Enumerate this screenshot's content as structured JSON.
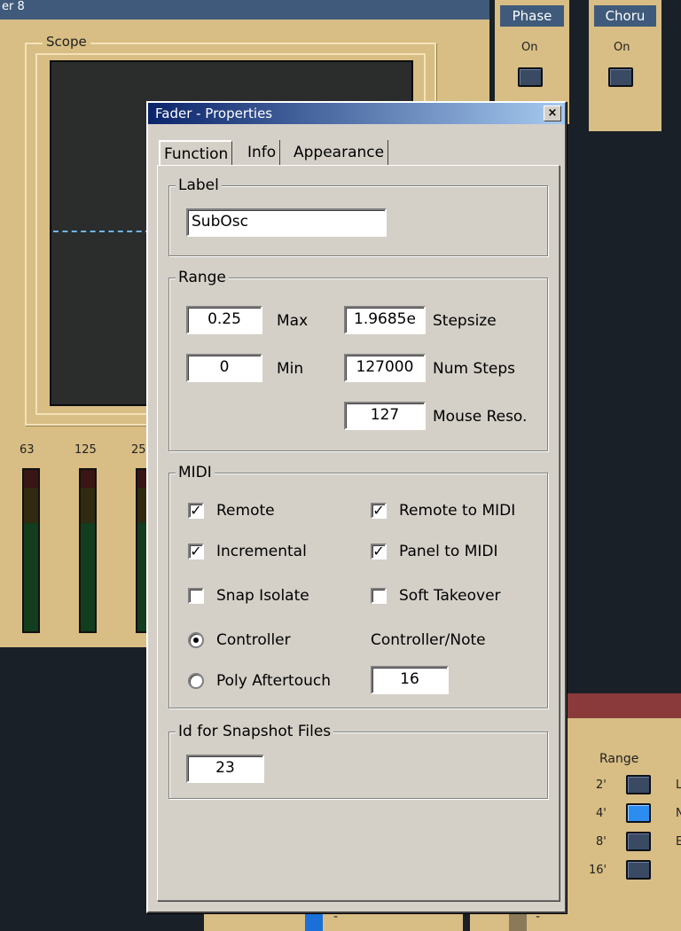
{
  "background": {
    "scope_panel_title": "er 8",
    "scope_label": "Scope",
    "meter_ticks": [
      "63",
      "125",
      "25"
    ],
    "phase": {
      "title": "Phase",
      "state": "On"
    },
    "chorus": {
      "title": "Choru",
      "state": "On"
    },
    "range_group": {
      "title": "Range",
      "options": [
        "2'",
        "4'",
        "8'",
        "16'"
      ],
      "selected": "4'",
      "side_letters": [
        "L",
        "N",
        "E"
      ]
    },
    "bottom_dashes": [
      "-",
      "-"
    ]
  },
  "dialog": {
    "title": "Fader - Properties",
    "close_glyph": "×",
    "tabs": [
      "Function",
      "Info",
      "Appearance"
    ],
    "active_tab": "Function",
    "label_group": {
      "title": "Label",
      "value": "SubOsc"
    },
    "range_group": {
      "title": "Range",
      "max": {
        "value": "0.25",
        "label": "Max"
      },
      "min": {
        "value": "0",
        "label": "Min"
      },
      "stepsize": {
        "value": "1.9685e",
        "label": "Stepsize"
      },
      "num_steps": {
        "value": "127000",
        "label": "Num Steps"
      },
      "mouse_reso": {
        "value": "127",
        "label": "Mouse Reso."
      }
    },
    "midi_group": {
      "title": "MIDI",
      "remote": {
        "label": "Remote",
        "checked": true
      },
      "remote_to_midi": {
        "label": "Remote to MIDI",
        "checked": true
      },
      "incremental": {
        "label": "Incremental",
        "checked": true
      },
      "panel_to_midi": {
        "label": "Panel to MIDI",
        "checked": true
      },
      "snap_isolate": {
        "label": "Snap Isolate",
        "checked": false
      },
      "soft_takeover": {
        "label": "Soft Takeover",
        "checked": false
      },
      "controller": {
        "label": "Controller",
        "selected": true
      },
      "poly_aftertouch": {
        "label": "Poly Aftertouch",
        "selected": false
      },
      "controller_note": {
        "label": "Controller/Note",
        "value": "16"
      }
    },
    "snapshot_group": {
      "title": "Id for Snapshot Files",
      "value": "23"
    }
  }
}
